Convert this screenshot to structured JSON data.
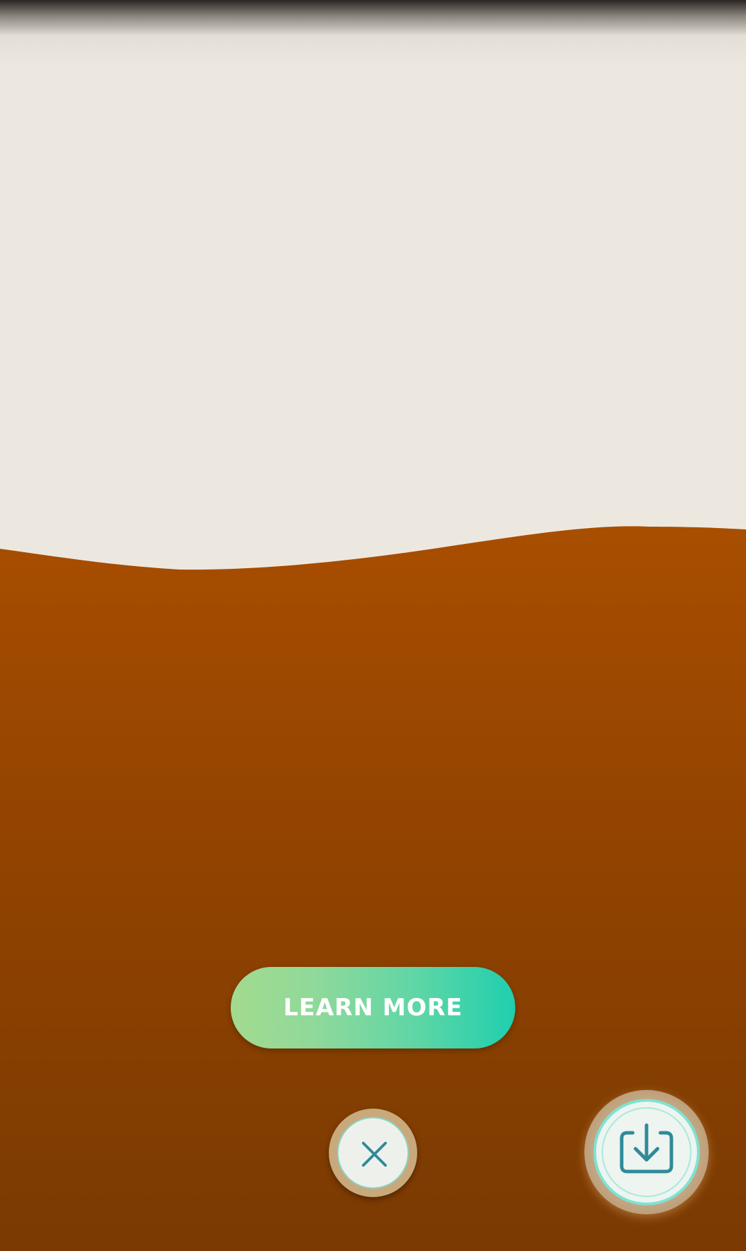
{
  "colors": {
    "background_light": "#ede8df",
    "background_orange_top": "#a84e00",
    "background_orange_bottom": "#7a3a02",
    "button_gradient_start": "#a3da8f",
    "button_gradient_end": "#1fcfae",
    "icon_teal": "#2f8a9a"
  },
  "actions": {
    "learn_more_label": "LEARN MORE",
    "close_icon": "close-icon",
    "save_icon": "download-icon"
  }
}
